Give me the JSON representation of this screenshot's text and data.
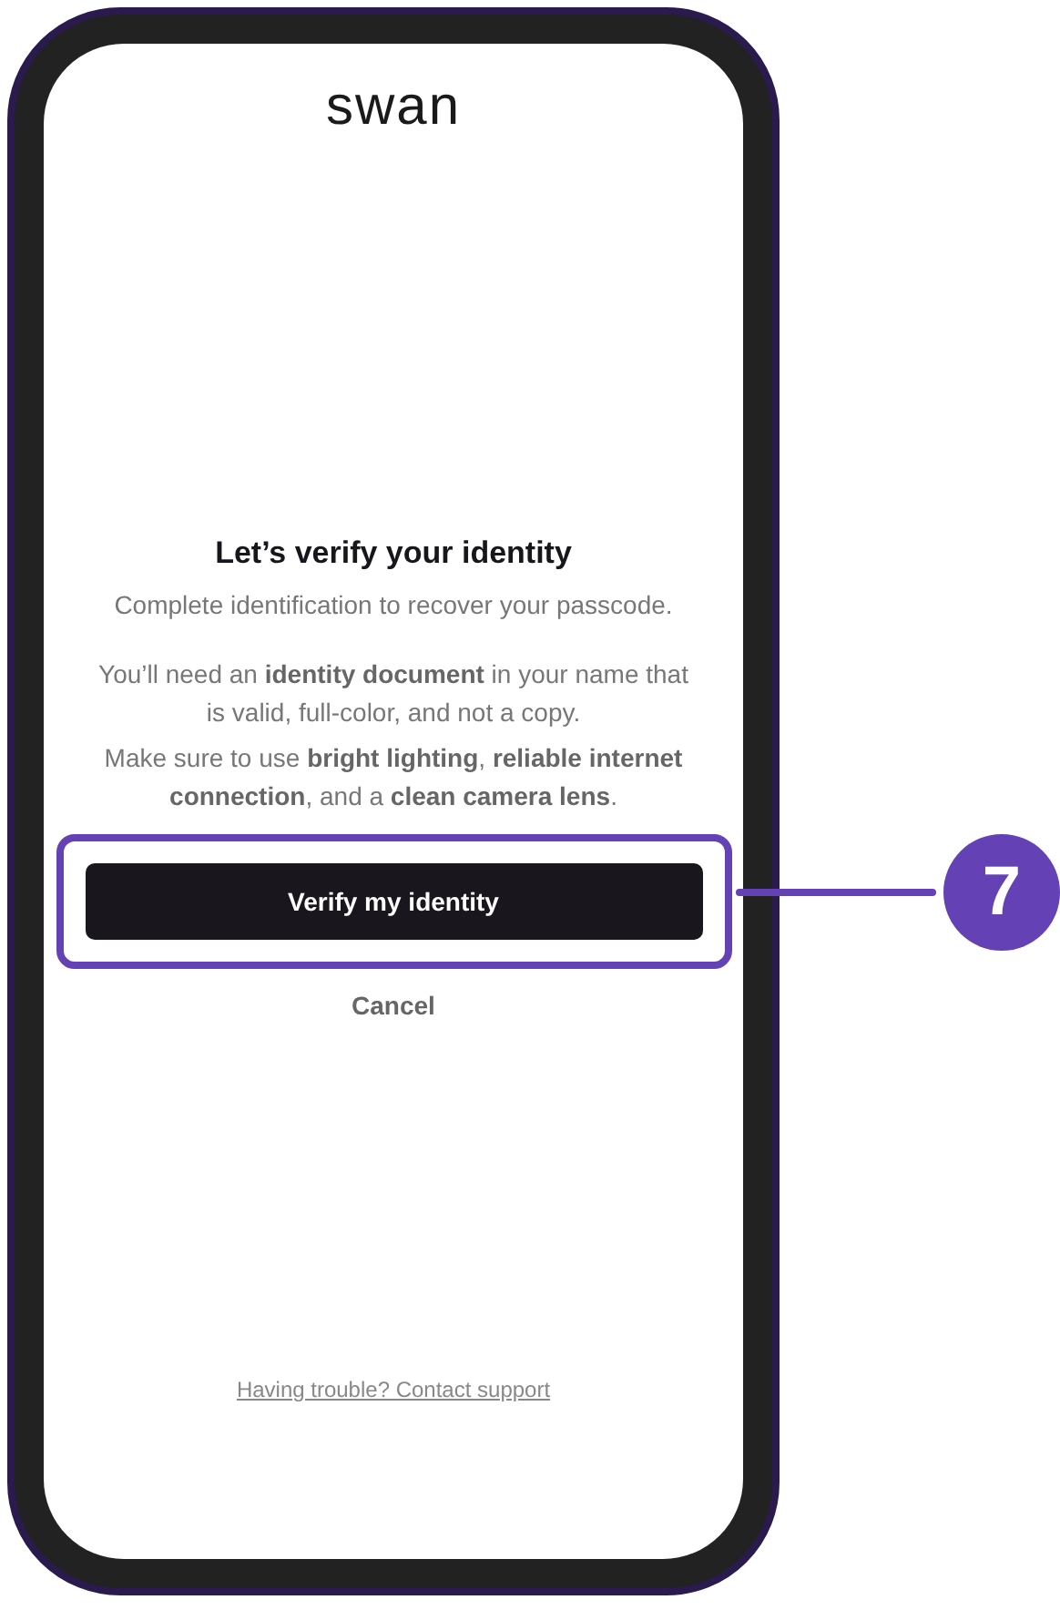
{
  "logo": "swan",
  "title": "Let’s verify your identity",
  "subtitle": "Complete identification to recover your passcode.",
  "paragraphs": [
    "You’ll need an **identity document** in your name that is valid, full-color, and not a copy.",
    "Make sure to use **bright lighting**, **reliable internet connection**, and a **clean camera lens**."
  ],
  "primary_button": {
    "label": "Verify my identity",
    "highlighted": true
  },
  "cancel_button": {
    "label": "Cancel"
  },
  "support_link": "Having trouble? Contact support",
  "callout": {
    "number": "7"
  }
}
